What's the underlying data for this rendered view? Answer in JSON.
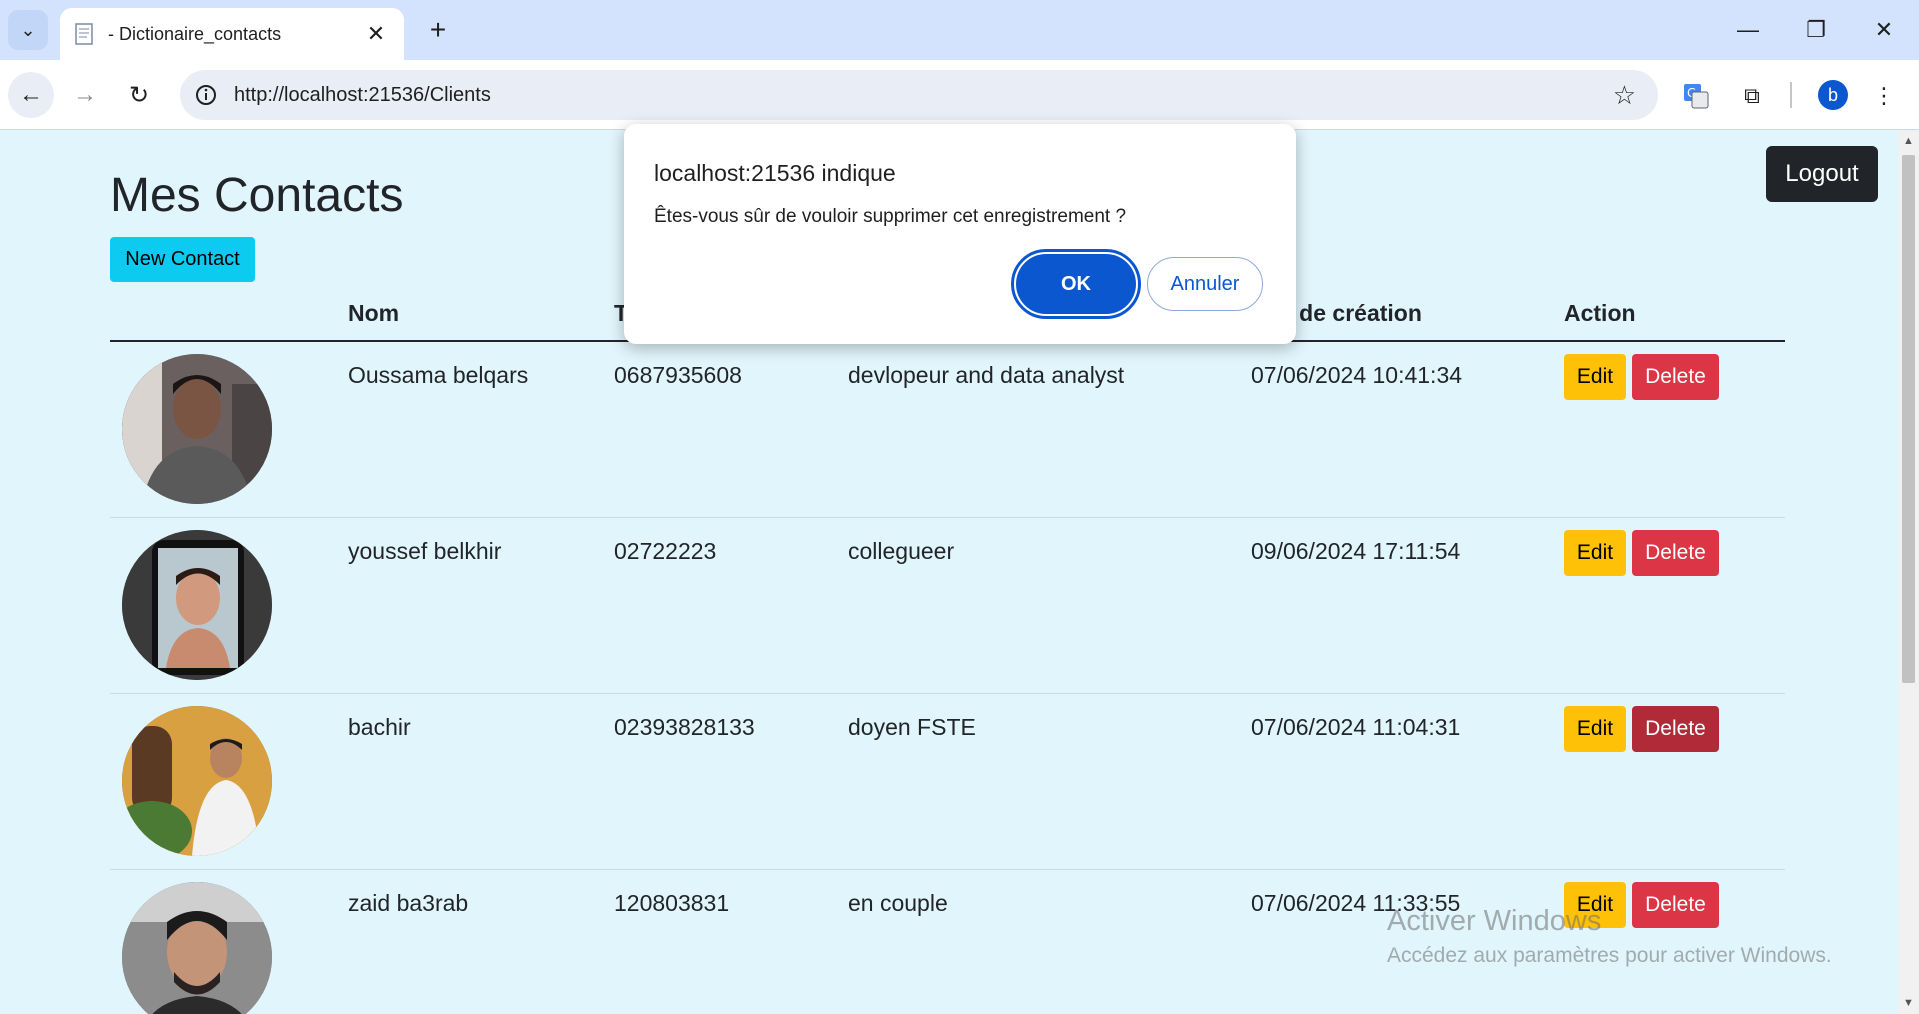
{
  "browser": {
    "tab_title": "- Dictionaire_contacts",
    "url": "http://localhost:21536/Clients",
    "profile_initial": "b",
    "accent": "#0b57d0"
  },
  "page": {
    "title": "Mes Contacts",
    "new_contact_label": "New Contact",
    "logout_label": "Logout",
    "columns": [
      "Nom",
      "T",
      "e de création",
      "Action"
    ],
    "rows": [
      {
        "nom": "Oussama belqars",
        "tel": "0687935608",
        "description": "devlopeur and data analyst",
        "date": "07/06/2024 10:41:34",
        "edit": "Edit",
        "delete": "Delete"
      },
      {
        "nom": "youssef belkhir",
        "tel": "02722223",
        "description": "collegueer",
        "date": "09/06/2024 17:11:54",
        "edit": "Edit",
        "delete": "Delete"
      },
      {
        "nom": "bachir",
        "tel": "02393828133",
        "description": "doyen FSTE",
        "date": "07/06/2024 11:04:31",
        "edit": "Edit",
        "delete": "Delete"
      },
      {
        "nom": "zaid ba3rab",
        "tel": "120803831",
        "description": "en couple",
        "date": "07/06/2024 11:33:55",
        "edit": "Edit",
        "delete": "Delete"
      }
    ],
    "colors": {
      "edit": "#ffc107",
      "delete": "#dc3545",
      "new_contact": "#0dcaf0",
      "logout": "#212529"
    }
  },
  "dialog": {
    "title": "localhost:21536 indique",
    "message": "Êtes-vous sûr de vouloir supprimer cet enregistrement ?",
    "ok_label": "OK",
    "cancel_label": "Annuler"
  },
  "watermark": {
    "line1": "Activer Windows",
    "line2": "Accédez aux paramètres pour activer Windows."
  }
}
